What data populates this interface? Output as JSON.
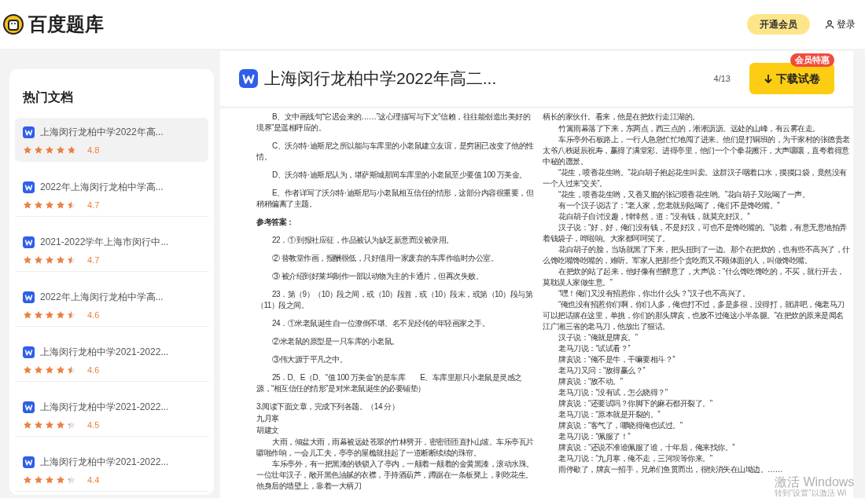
{
  "header": {
    "logo_text": "百度题库",
    "vip_button": "开通会员",
    "login": "登录"
  },
  "sidebar": {
    "title": "热门文档",
    "items": [
      {
        "title": "上海闵行龙柏中学2022年高...",
        "stars": 4.8,
        "rating": "4.8",
        "selected": true
      },
      {
        "title": "2022年上海闵行龙柏中学高...",
        "stars": 4.5,
        "rating": "4.7",
        "selected": false
      },
      {
        "title": "2021-2022学年上海市闵行中...",
        "stars": 4.5,
        "rating": "4.7",
        "selected": false
      },
      {
        "title": "2022年上海闵行龙柏中学高...",
        "stars": 4.5,
        "rating": "4.6",
        "selected": false
      },
      {
        "title": "上海闵行龙柏中学2021-2022...",
        "stars": 4.5,
        "rating": "4.6",
        "selected": false
      },
      {
        "title": "上海闵行龙柏中学2021-2022...",
        "stars": 4.3,
        "rating": "4.5",
        "selected": false
      },
      {
        "title": "上海闵行龙柏中学2021-2022...",
        "stars": 4.3,
        "rating": "4.4",
        "selected": false
      }
    ]
  },
  "document": {
    "title": "上海闵行龙柏中学2022年高二...",
    "page": "4/13",
    "download_button": "下载试卷",
    "badge": "会员特惠",
    "left_column": [
      {
        "kind": "answer",
        "text": "B、文中画线句“它迟会来的……”这心理描写与下文“信赖，往往能创造出美好的境界”是遥相呼应的。"
      },
      {
        "kind": "answer",
        "text": "C、沃尔特·迪斯尼之所以能与车库里的小老鼠建立友谊，是穷困已改变了他的性情。"
      },
      {
        "kind": "answer",
        "text": "D、沃尔特·迪斯尼认为，堪萨斯城那间车库里的小老鼠至少要值 100 万美金。"
      },
      {
        "kind": "answer",
        "text": "E、作者详写了沃尔特·迪斯尼与小老鼠相互信任的情形，这部分内容很重要，但稍稍偏离了主题。"
      },
      {
        "kind": "heading",
        "text": "参考答案："
      },
      {
        "kind": "answer",
        "text": "22．① 到报社应征，作品被认为缺乏新意而没被录用。"
      },
      {
        "kind": "answer",
        "text": "② 替教堂作画，报酬很低，只好借用一家废弃的车库作临时办公室。"
      },
      {
        "kind": "answer",
        "text": "③ 被介绍到好莱坞制作一部以动物为主的卡通片，但再次失败。"
      },
      {
        "kind": "answer",
        "text": "23．第（9）（10）段之间，或（10）段首，或（10）段末，或第（10）段与第（11）段之间。"
      },
      {
        "kind": "answer",
        "text": "24．①米老鼠诞生自一位潦倒不堪、名不见经传的年轻画家之手。"
      },
      {
        "kind": "answer",
        "text": "②米老鼠的原型是一只车库的小老鼠。"
      },
      {
        "kind": "answer",
        "text": "③伟大源于平凡之中。"
      },
      {
        "kind": "answer",
        "text": "25．D、E（D、“值 100 万美金”的是车库　　E、车库里那只小老鼠是灵感之源，“相互信任的情形”是对米老鼠诞生的必要铺垫）"
      },
      {
        "kind": "line",
        "text": "3.阅读下面文章，完成下列各题。（14 分）"
      },
      {
        "kind": "line",
        "text": "九月寒"
      },
      {
        "kind": "line",
        "text": "胡建文"
      },
      {
        "kind": "body",
        "text": "大雨，倾盆大雨，雨幕被远处苍翠的竹林劈开，密密匝匝直扑山坡。车乐亭瓦片噼啪作响，一会儿工夫，亭亭的屋檐就挂起了一道断断续续的珠帘。"
      },
      {
        "kind": "body",
        "text": "车乐亭外，有一把黑漆的铁锁入了亭内，一颠着一颠着的金黄黑漆，滚动水珠。一位壮年汉子，敞开黑色油腻的衣襟，手持酒葫芦，蹲踞在一条板凳上，剥吃花生。他身后的墙壁上，靠着一大柄刀"
      }
    ],
    "right_column": [
      {
        "kind": "line",
        "text": "柄长的家伙什。看来，他是在把炊行走江湖的。"
      },
      {
        "kind": "body",
        "text": "竹篱雨幕落了下来，东两点，西三点的，淅淅沥沥。远处的山峰，有云雾在走。"
      },
      {
        "kind": "body",
        "text": "车乐亭外石板路上，一行人急急忙忙地闯了进来。他们是打铜班的，为千家村的张德贵老太爷八秩诞辰祝寿，赢得了满堂彩。进得亭里，他们一个个拳花擦汗，大声嚷嚷，直夸着得意中秘的愿景。"
      },
      {
        "kind": "body",
        "text": "“花生，喷香花生哟。”花白胡子抱起花生叫卖。这群汉子咽着口水，摸摸口袋，竟然没有一个人过来“交关”。"
      },
      {
        "kind": "body",
        "text": "“花生，喷香花生哟，又香又脆的张记喷香花生哟。”花白胡子又吆喝了一声。"
      },
      {
        "kind": "body",
        "text": "有一个汉子说话了：“老人家，您老就别吆喝了，俺们不是馋吃嘴。”"
      },
      {
        "kind": "body",
        "text": "花白胡子自讨没趣，悻悻然，道：“没有钱，就莫充好汉。”"
      },
      {
        "kind": "body",
        "text": "汉子说：“好，好，俺们没有钱，不是好汉，可也不是馋吃嘴的。”说着，有意无意地拍弄着钱袋子，哗啦响。大家都呵呵笑了。"
      },
      {
        "kind": "body",
        "text": "花白胡子的脸，当场就黑了下来，把头扭到了一边。那个在把炊的，也有些不高兴了，什么馋吃嘴馋吃嘴的，难听。军家人把那些个贪吃而又不顾体面的人，叫做馋吃嘴。"
      },
      {
        "kind": "body",
        "text": "在把炊的站了起来，他好像有些醉意了，大声说：“什么馋吃馋吃的，不买，就行开去，莫耽误人家做生意。”"
      },
      {
        "kind": "body",
        "text": "“嘿！俺们又没有招惹你，你出什么头？”汉子也不高兴了。"
      },
      {
        "kind": "body",
        "text": "“俺也没有招惹你们啊，你们人多，俺也打不过，多是多很，没得打，就讲吧，俺老马刀可以把话撂在这里，单挑，你们的那头牌亥，也敌不过俺这小半条腿。”在把炊的原来是闻名江广湘三省的老马刀，他放出了狠话。"
      },
      {
        "kind": "body",
        "text": "汉子说：“俺就是牌亥。”"
      },
      {
        "kind": "body",
        "text": "老马刀说：“试试看？”"
      },
      {
        "kind": "body",
        "text": "牌亥说：“俺不是牛，干嘛要相斗？”"
      },
      {
        "kind": "body",
        "text": "老马刀又问：“敌得赢么？”"
      },
      {
        "kind": "body",
        "text": "牌亥说：“敌不动。”"
      },
      {
        "kind": "body",
        "text": "老马刀说：“没有试，怎么晓得？”"
      },
      {
        "kind": "body",
        "text": "牌亥说：“还要试吗？你脚下的麻石都开裂了。”"
      },
      {
        "kind": "body",
        "text": "老马刀说：“原本就是开裂的。”"
      },
      {
        "kind": "body",
        "text": "牌亥说：“客气了，哪晓得俺也试过。”"
      },
      {
        "kind": "body",
        "text": "老马刀说：“佩服了！”"
      },
      {
        "kind": "body",
        "text": "牌亥说：“还说不准谁佩服了谁，十年后，俺来找你。”"
      },
      {
        "kind": "body",
        "text": "老马刀说：“九月寒，俺不走，三河坝等你来。”"
      },
      {
        "kind": "body",
        "text": "雨停歇了，牌亥一招手，兄弟们鱼贯而出，很快消失在山坳边。……"
      }
    ]
  },
  "os_overlay": {
    "title": "激活 Windows",
    "subtitle": "转到“设置”以激活 Wi"
  }
}
